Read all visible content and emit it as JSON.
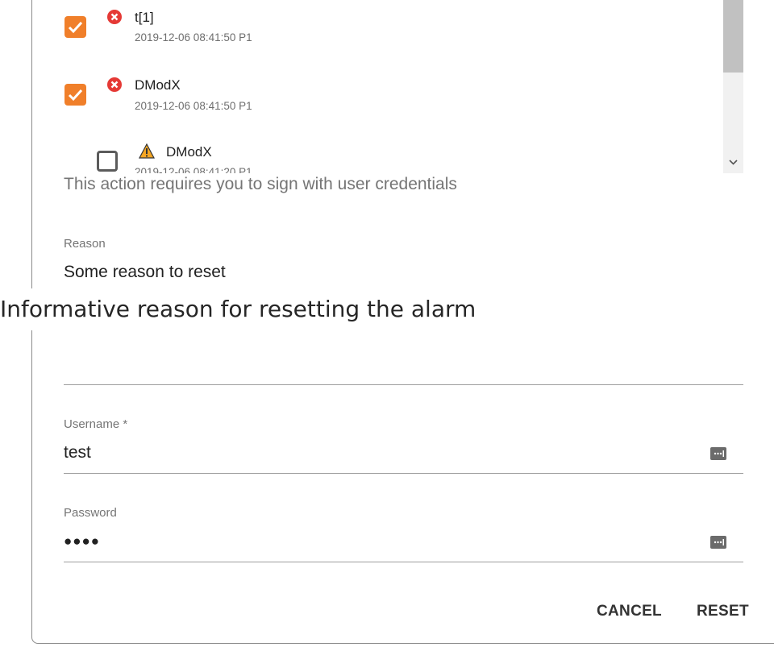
{
  "alarms": [
    {
      "name": "t[1]",
      "meta": "2019-12-06 08:41:50 P1",
      "checked": true,
      "severity": "error"
    },
    {
      "name": "DModX",
      "meta": "2019-12-06 08:41:50 P1",
      "checked": true,
      "severity": "error"
    },
    {
      "name": "DModX",
      "meta": "2019-12-06 08:41:20 P1",
      "checked": false,
      "severity": "warning"
    }
  ],
  "sign_notice": "This action requires you to sign with user credentials",
  "reason": {
    "label": "Reason",
    "value": "Some reason to reset",
    "helper": "Informative reason for resetting the alarm"
  },
  "username": {
    "label": "Username *",
    "value": "test"
  },
  "password": {
    "label": "Password",
    "value": "●●●●"
  },
  "actions": {
    "cancel": "CANCEL",
    "reset": "RESET"
  },
  "colors": {
    "accent": "#f07f2a",
    "error": "#e53935",
    "warning": "#f5a623"
  }
}
